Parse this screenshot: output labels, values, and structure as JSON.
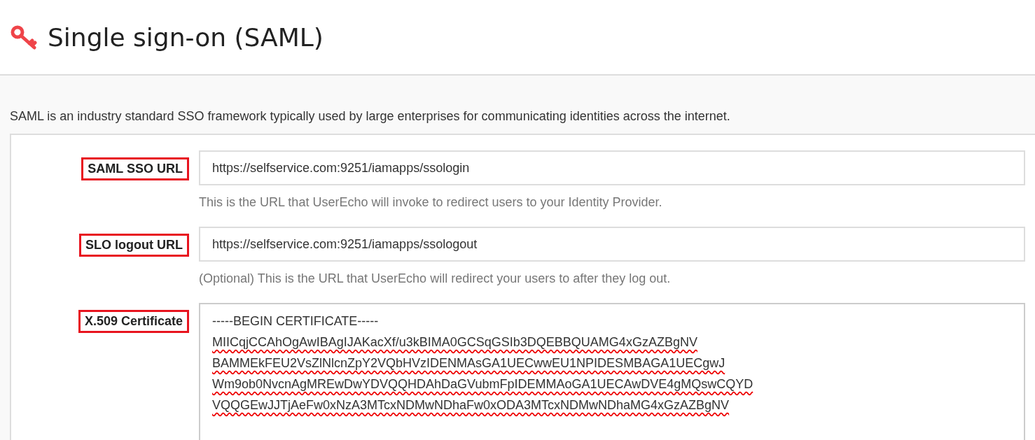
{
  "header": {
    "title": "Single sign-on (SAML)"
  },
  "description": "SAML is an industry standard SSO framework typically used by large enterprises for communicating identities across the internet.",
  "fields": [
    {
      "kind": "input",
      "label": "SAML SSO URL",
      "highlighted": true,
      "value": "https://selfservice.com:9251/iamapps/ssologin",
      "help": "This is the URL that UserEcho will invoke to redirect users to your Identity Provider."
    },
    {
      "kind": "input",
      "label": "SLO logout URL",
      "highlighted": true,
      "value": "https://selfservice.com:9251/iamapps/ssologout",
      "help": "(Optional) This is the URL that UserEcho will redirect your users to after they log out."
    },
    {
      "kind": "textarea",
      "label": "X.509 Certificate",
      "highlighted": true,
      "lines": [
        {
          "text": "-----BEGIN CERTIFICATE-----",
          "misspelled": false
        },
        {
          "text": "MIICqjCCAhOgAwIBAgIJAKacXf/u3kBIMA0GCSqGSIb3DQEBBQUAMG4xGzAZBgNV",
          "misspelled": true
        },
        {
          "text": "BAMMEkFEU2VsZlNlcnZpY2VQbHVzIDENMAsGA1UECwwEU1NPIDESMBAGA1UECgwJ",
          "misspelled": true
        },
        {
          "text": "Wm9ob0NvcnAgMREwDwYDVQQHDAhDaGVubmFpIDEMMAoGA1UECAwDVE4gMQswCQYD",
          "misspelled": true
        },
        {
          "text": "VQQGEwJJTjAeFw0xNzA3MTcxNDMwNDhaFw0xODA3MTcxNDMwNDhaMG4xGzAZBgNV",
          "misspelled": true
        }
      ]
    }
  ]
}
